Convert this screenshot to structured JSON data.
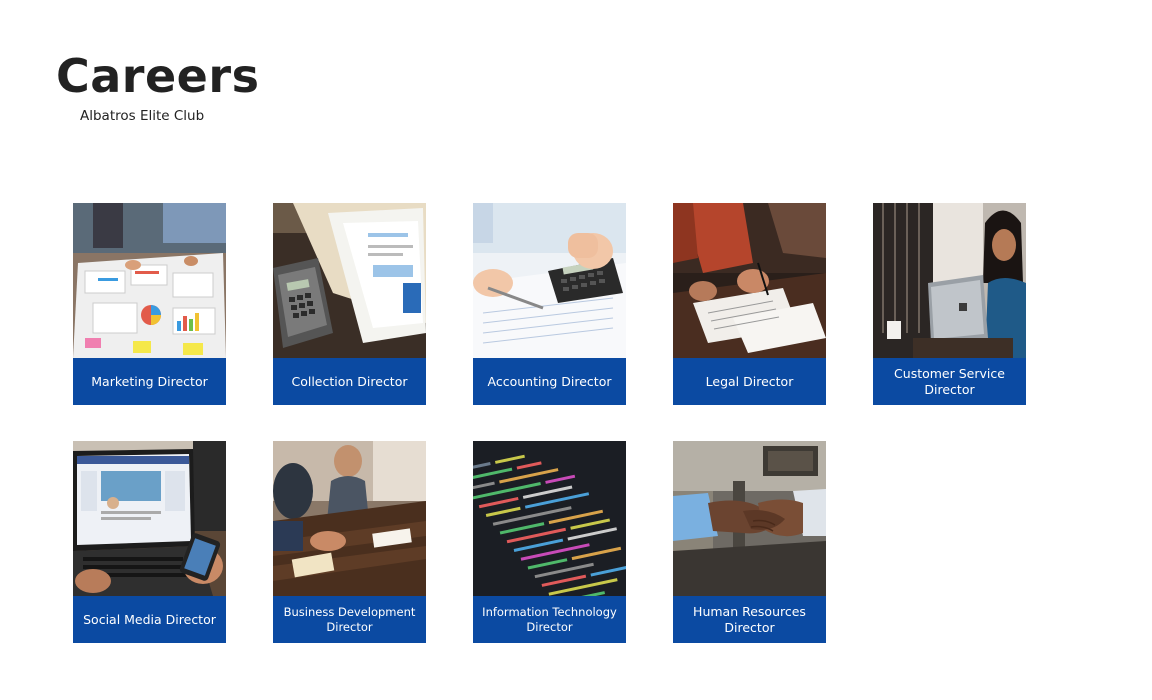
{
  "header": {
    "title": "Careers",
    "subtitle": "Albatros Elite Club"
  },
  "colors": {
    "label_bg": "#0b4aa2",
    "label_text": "#ffffff",
    "title_text": "#222222"
  },
  "cards": [
    {
      "label": "Marketing Director",
      "photo": "marketing-charts-photo"
    },
    {
      "label": "Collection Director",
      "photo": "invoice-calculator-photo"
    },
    {
      "label": "Accounting Director",
      "photo": "calculator-accounting-photo"
    },
    {
      "label": "Legal Director",
      "photo": "signing-documents-photo"
    },
    {
      "label": "Customer Service Director",
      "photo": "woman-laptop-photo"
    },
    {
      "label": "Social Media Director",
      "photo": "laptop-social-media-photo"
    },
    {
      "label": "Business Development Director",
      "photo": "meeting-table-photo"
    },
    {
      "label": "Information Technology Director",
      "photo": "code-screen-photo"
    },
    {
      "label": "Human Resources Director",
      "photo": "handshake-photo"
    }
  ]
}
